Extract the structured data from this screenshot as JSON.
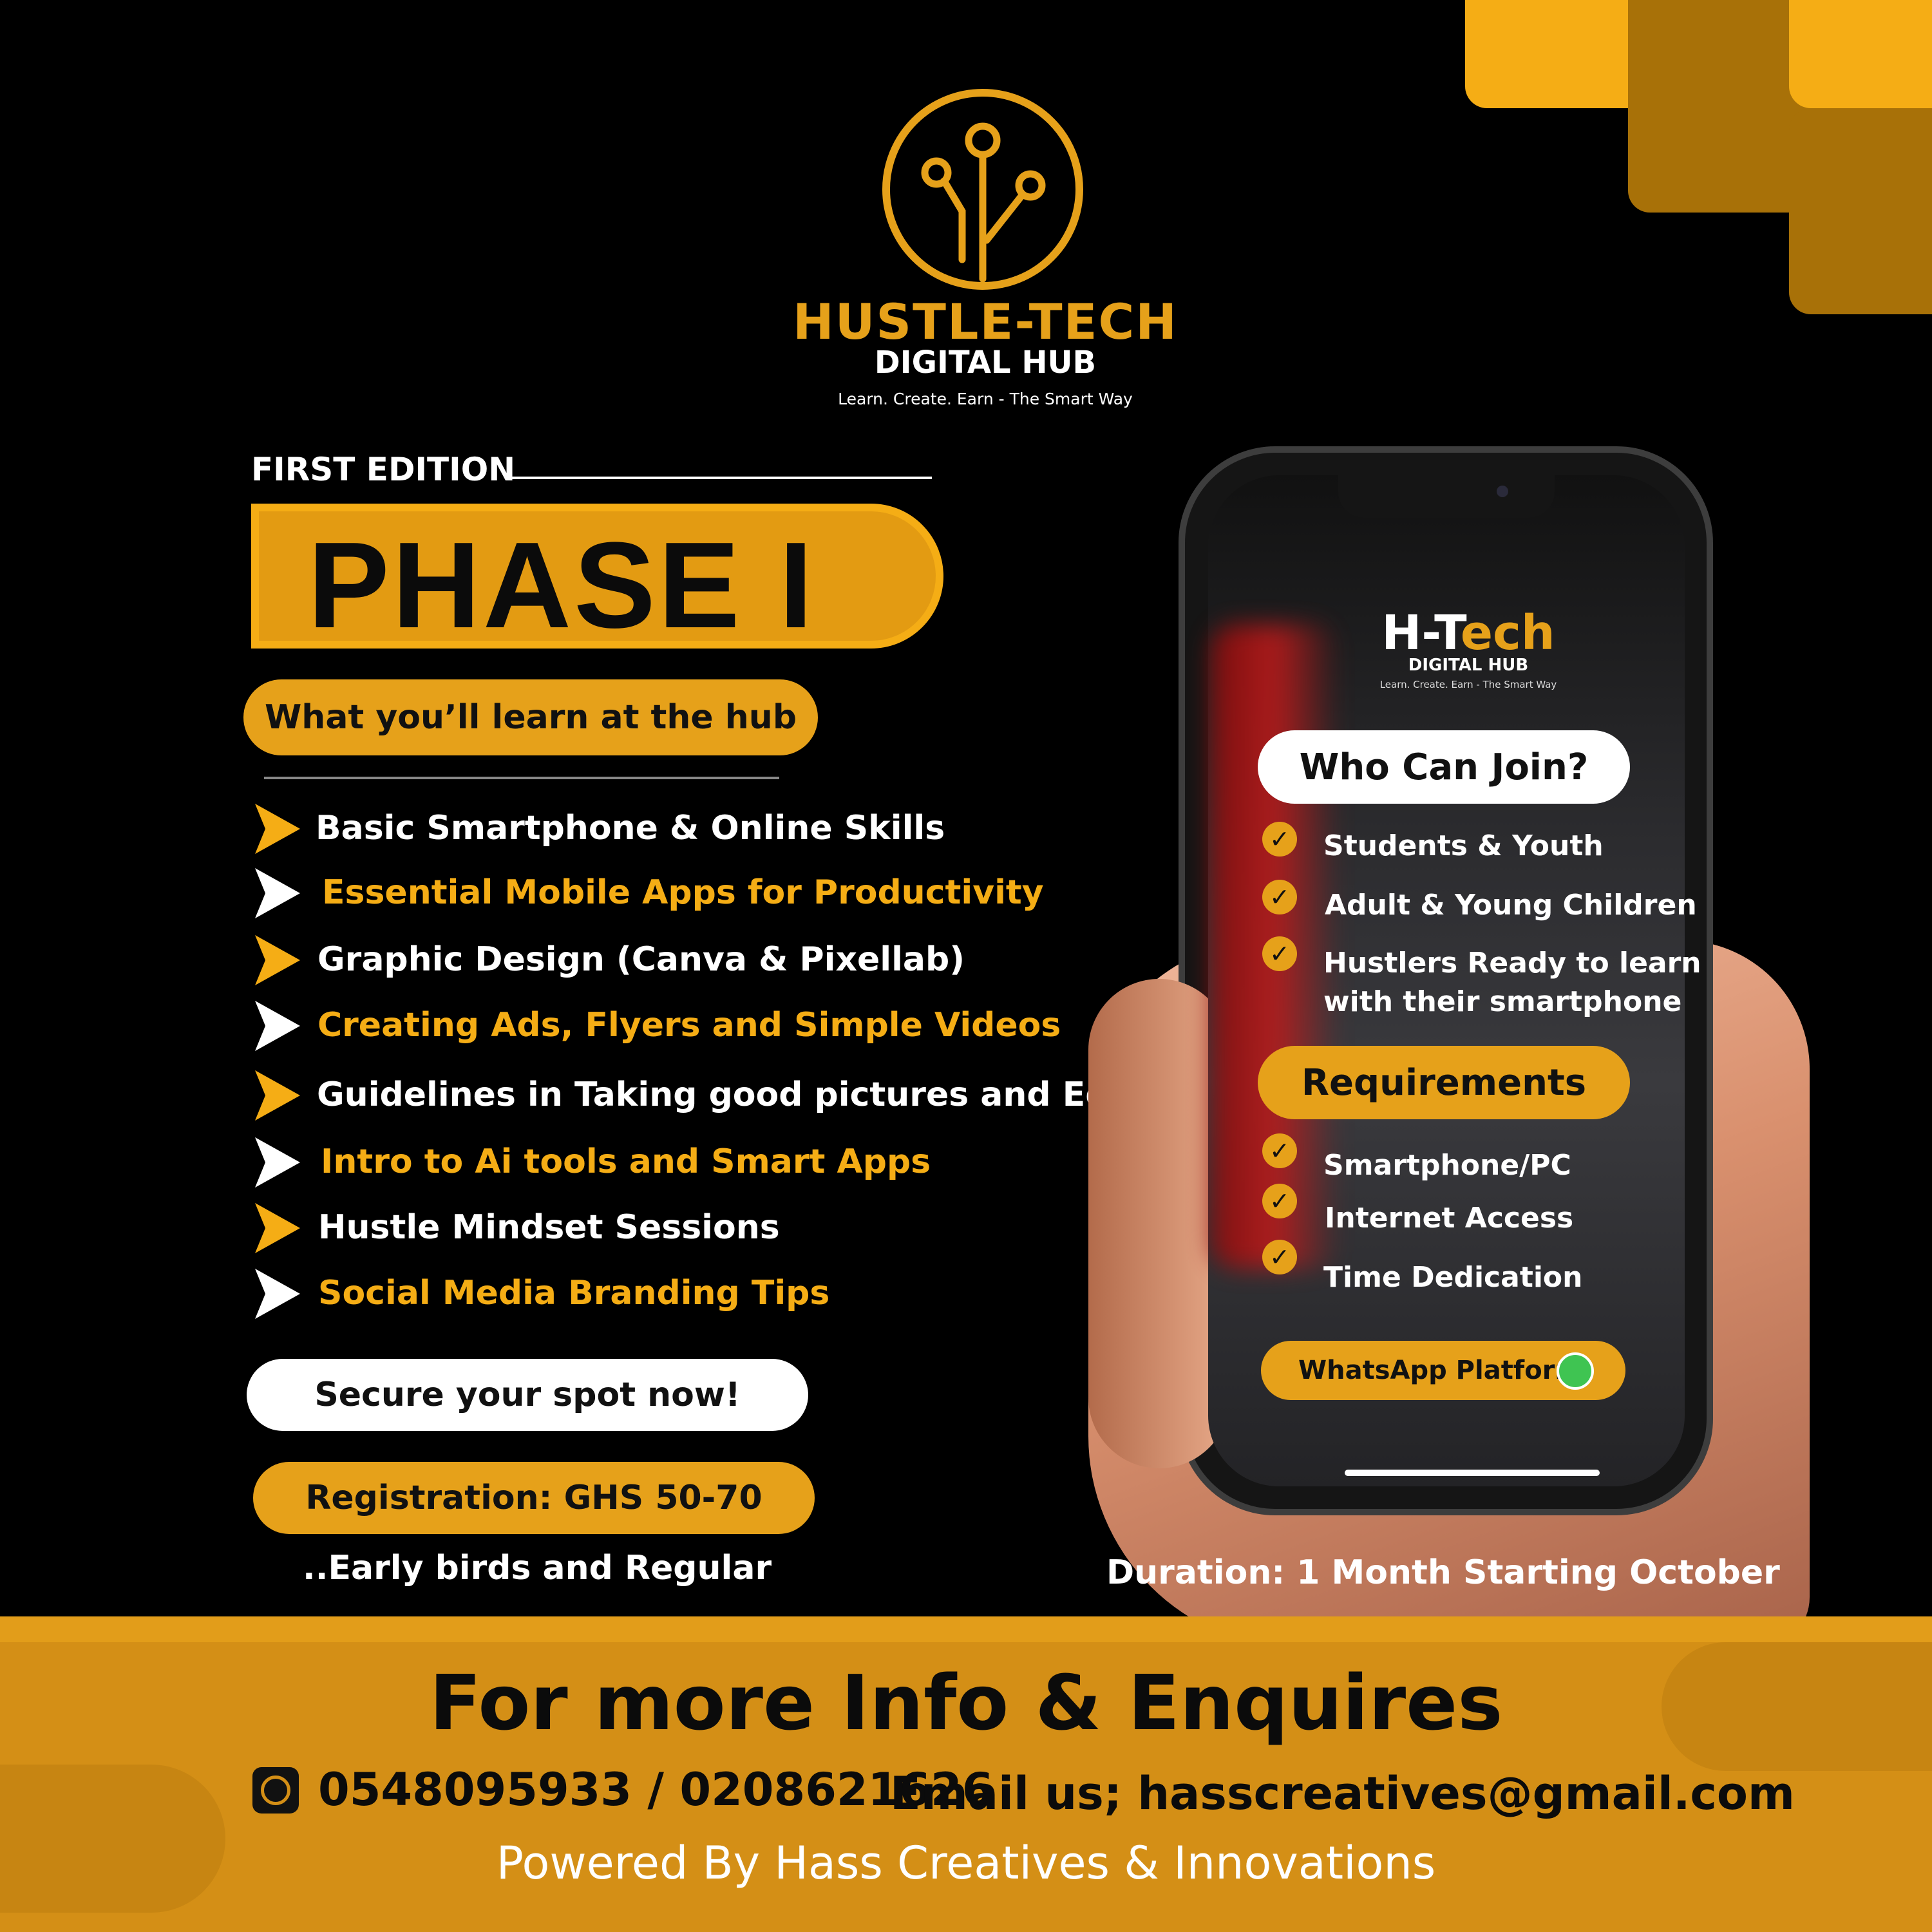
{
  "brand": {
    "name": "HUSTLE-TECH",
    "subtitle": "DIGITAL HUB",
    "tagline": "Learn. Create. Earn - The Smart Way"
  },
  "edition_label": "FIRST EDITION",
  "phase_title": "PHASE I",
  "learn_heading": "What you’ll learn at the hub",
  "topics": [
    {
      "label": "Basic Smartphone & Online Skills",
      "color": "#ffffff",
      "arrow_color": "#f5ad15"
    },
    {
      "label": "Essential Mobile Apps for Productivity",
      "color": "#f5ad15",
      "arrow_color": "#ffffff"
    },
    {
      "label": "Graphic Design (Canva & Pixellab)",
      "color": "#ffffff",
      "arrow_color": "#f5ad15"
    },
    {
      "label": "Creating Ads, Flyers and Simple Videos",
      "color": "#f5ad15",
      "arrow_color": "#ffffff"
    },
    {
      "label": "Guidelines in Taking good pictures and Editing",
      "color": "#ffffff",
      "arrow_color": "#f5ad15"
    },
    {
      "label": "Intro to Ai tools and Smart Apps",
      "color": "#f5ad15",
      "arrow_color": "#ffffff"
    },
    {
      "label": "Hustle Mindset Sessions",
      "color": "#ffffff",
      "arrow_color": "#f5ad15"
    },
    {
      "label": "Social Media Branding Tips",
      "color": "#f5ad15",
      "arrow_color": "#ffffff"
    }
  ],
  "secure_cta": "Secure your spot now!",
  "registration": "Registration: GHS 50-70",
  "registration_note": "..Early birds and Regular",
  "phone_screen": {
    "title_part1": "H-T",
    "title_part2": "ech",
    "subtitle": "DIGITAL HUB",
    "tagline": "Learn. Create. Earn - The Smart Way",
    "who_heading": "Who Can Join?",
    "who_items": [
      "Students & Youth",
      "Adult & Young Children",
      "Hustlers Ready to learn",
      "with their smartphone"
    ],
    "requirements_heading": "Requirements",
    "requirement_items": [
      "Smartphone/PC",
      "Internet Access",
      "Time Dedication"
    ],
    "whatsapp_label": "WhatsApp Platform"
  },
  "duration": "Duration: 1 Month Starting October",
  "footer": {
    "title": "For more Info & Enquires",
    "phones": "0548095933 / 0208621626",
    "email": "Email us; hasscreatives@gmail.com",
    "powered_by": "Powered By Hass Creatives & Innovations"
  },
  "colors": {
    "accent": "#e6a11a",
    "background": "#000000",
    "footer": "#d48f16"
  },
  "icons": [
    "logo-circuit-icon",
    "arrow-right-icon",
    "check-circle-icon",
    "whatsapp-icon"
  ]
}
